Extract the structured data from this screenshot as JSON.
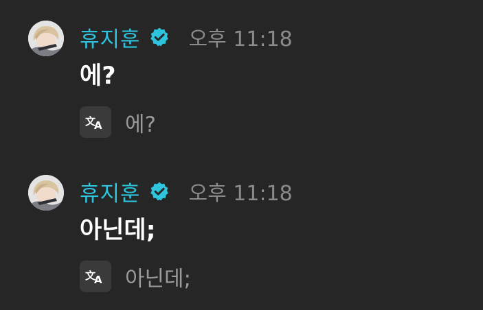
{
  "messages": [
    {
      "author": "휴지훈",
      "time": "오후 11:18",
      "text": "에?",
      "translation": "에?"
    },
    {
      "author": "휴지훈",
      "time": "오후 11:18",
      "text": "아닌데;",
      "translation": "아닌데;"
    }
  ],
  "colors": {
    "background": "#262626",
    "username": "#2ec4de",
    "verified_badge": "#2ec4de",
    "timestamp": "#8b8b8b",
    "message_text": "#ffffff",
    "translated_text": "#9a9a9a",
    "translate_button_bg": "#3a3a3a"
  },
  "icons": {
    "verified": "verified-badge-icon",
    "translate": "translate-icon"
  }
}
